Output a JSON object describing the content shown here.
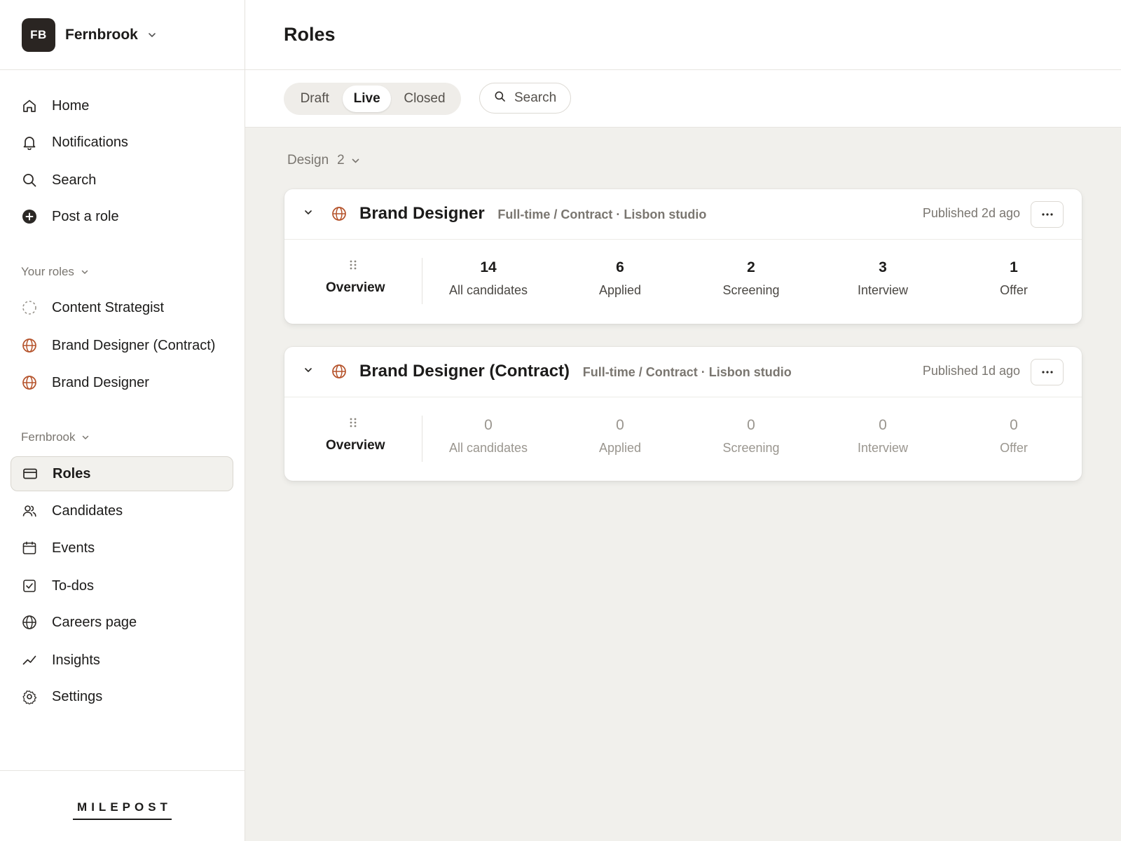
{
  "org": {
    "initials": "FB",
    "name": "Fernbrook"
  },
  "nav_top": [
    {
      "label": "Home",
      "icon": "home-icon"
    },
    {
      "label": "Notifications",
      "icon": "bell-icon"
    },
    {
      "label": "Search",
      "icon": "search-icon"
    },
    {
      "label": "Post a role",
      "icon": "plus-circle-icon"
    }
  ],
  "your_roles": {
    "label": "Your roles",
    "items": [
      {
        "label": "Content Strategist",
        "icon": "draft-circle-icon"
      },
      {
        "label": "Brand Designer (Contract)",
        "icon": "globe-icon"
      },
      {
        "label": "Brand Designer",
        "icon": "globe-icon"
      }
    ]
  },
  "workspace": {
    "label": "Fernbrook",
    "items": [
      {
        "label": "Roles",
        "icon": "card-icon",
        "active": true
      },
      {
        "label": "Candidates",
        "icon": "users-icon"
      },
      {
        "label": "Events",
        "icon": "calendar-icon"
      },
      {
        "label": "To-dos",
        "icon": "checkbox-icon"
      },
      {
        "label": "Careers page",
        "icon": "globe-icon"
      },
      {
        "label": "Insights",
        "icon": "trend-icon"
      },
      {
        "label": "Settings",
        "icon": "gear-icon"
      }
    ]
  },
  "footer_brand": "MILEPOST",
  "page_title": "Roles",
  "status_tabs": {
    "draft": "Draft",
    "live": "Live",
    "closed": "Closed",
    "selected": "Live"
  },
  "search_label": "Search",
  "group": {
    "name": "Design",
    "count": "2"
  },
  "colors": {
    "accent": "#b5532b",
    "active_bg": "#f2f1ed"
  },
  "roles": [
    {
      "title": "Brand Designer",
      "meta": "Full-time / Contract · Lisbon studio",
      "published": "Published 2d ago",
      "overview": "Overview",
      "stats": [
        {
          "value": "14",
          "label": "All candidates"
        },
        {
          "value": "6",
          "label": "Applied"
        },
        {
          "value": "2",
          "label": "Screening"
        },
        {
          "value": "3",
          "label": "Interview"
        },
        {
          "value": "1",
          "label": "Offer"
        }
      ]
    },
    {
      "title": "Brand Designer (Contract)",
      "meta": "Full-time / Contract · Lisbon studio",
      "published": "Published 1d ago",
      "overview": "Overview",
      "stats": [
        {
          "value": "0",
          "label": "All candidates"
        },
        {
          "value": "0",
          "label": "Applied"
        },
        {
          "value": "0",
          "label": "Screening"
        },
        {
          "value": "0",
          "label": "Interview"
        },
        {
          "value": "0",
          "label": "Offer"
        }
      ]
    }
  ]
}
